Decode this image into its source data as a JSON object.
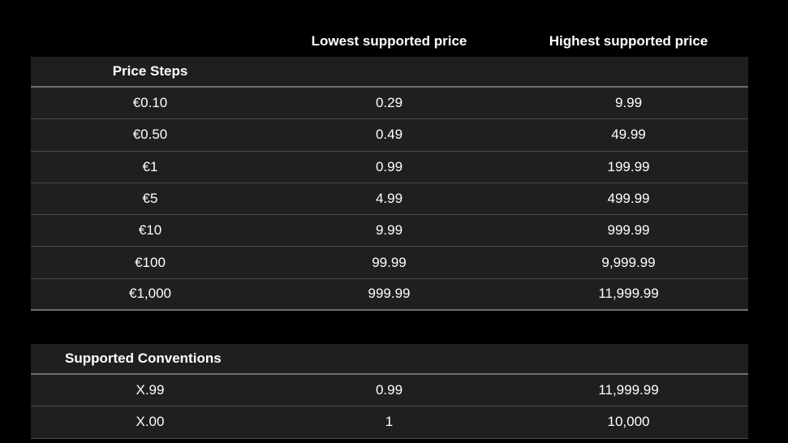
{
  "columns": {
    "lowest": "Lowest supported price",
    "highest": "Highest supported price"
  },
  "price_steps": {
    "title": "Price Steps",
    "rows": [
      {
        "step": "€0.10",
        "lowest": "0.29",
        "highest": "9.99"
      },
      {
        "step": "€0.50",
        "lowest": "0.49",
        "highest": "49.99"
      },
      {
        "step": "€1",
        "lowest": "0.99",
        "highest": "199.99"
      },
      {
        "step": "€5",
        "lowest": "4.99",
        "highest": "499.99"
      },
      {
        "step": "€10",
        "lowest": "9.99",
        "highest": "999.99"
      },
      {
        "step": "€100",
        "lowest": "99.99",
        "highest": "9,999.99"
      },
      {
        "step": "€1,000",
        "lowest": "999.99",
        "highest": "11,999.99"
      }
    ]
  },
  "supported_conventions": {
    "title": "Supported Conventions",
    "rows": [
      {
        "step": "X.99",
        "lowest": "0.99",
        "highest": "11,999.99"
      },
      {
        "step": "X.00",
        "lowest": "1",
        "highest": "10,000"
      }
    ]
  },
  "colors": {
    "background": "#000000",
    "table_bg": "#1f1f1f",
    "divider": "#4a4a4a",
    "heavy_divider": "#6e6e6e",
    "text": "#ffffff"
  }
}
